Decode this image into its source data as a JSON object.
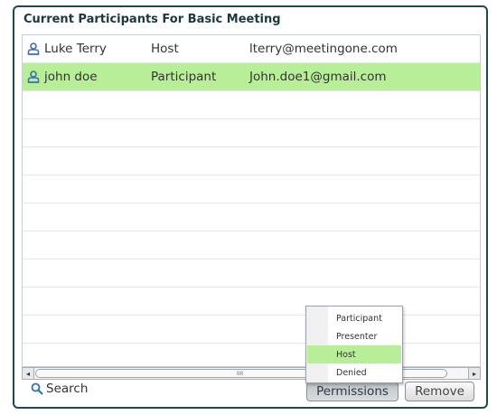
{
  "panel": {
    "title": "Current Participants For Basic Meeting"
  },
  "participants": [
    {
      "name": "Luke  Terry",
      "role": "Host",
      "email": "lterry@meetingone.com",
      "selected": false,
      "icon": "user-icon"
    },
    {
      "name": "john doe",
      "role": "Participant",
      "email": "John.doe1@gmail.com",
      "selected": true,
      "icon": "user-icon"
    }
  ],
  "scrollbar": {
    "left_arrow": "◂",
    "right_arrow": "▸",
    "grip": "IIII"
  },
  "search": {
    "label": "Search",
    "icon": "search-icon"
  },
  "buttons": {
    "permissions": "Permissions",
    "remove": "Remove"
  },
  "permissions_menu": {
    "items": [
      "Participant",
      "Presenter",
      "Host",
      "Denied"
    ],
    "active": "Host"
  },
  "colors": {
    "accent_green": "#b8ee98",
    "border_dark": "#1f4a48",
    "title_text": "#1d3640"
  }
}
